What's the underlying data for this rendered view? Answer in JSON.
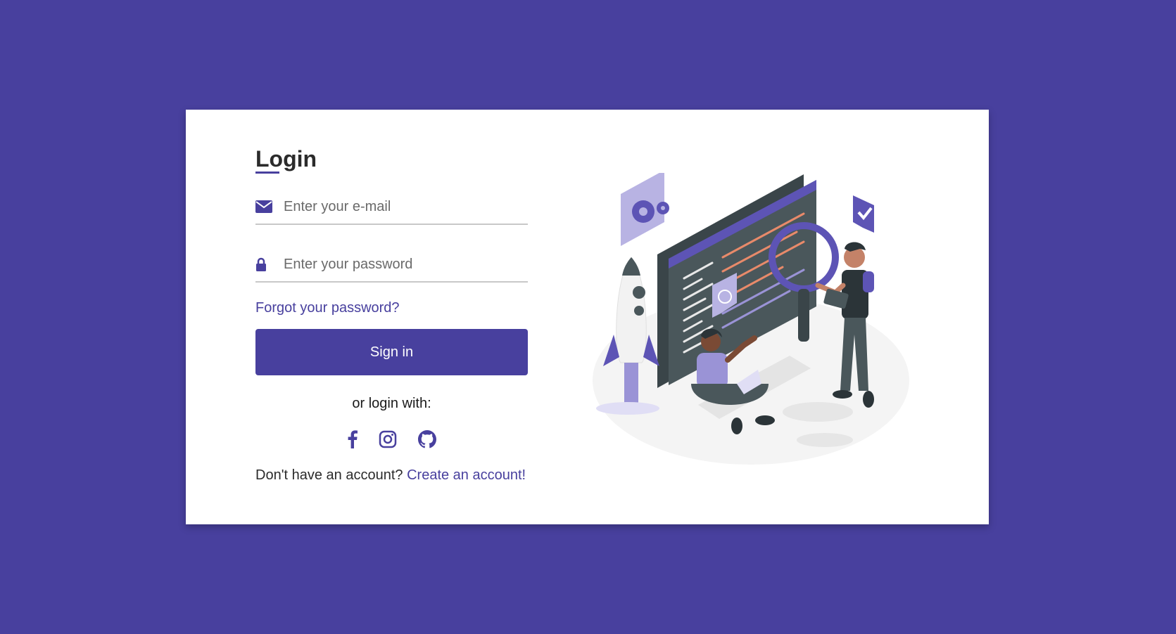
{
  "login": {
    "title": "Login",
    "email_placeholder": "Enter your e-mail",
    "password_placeholder": "Enter your password",
    "forgot_label": "Forgot your password?",
    "signin_label": "Sign in",
    "or_label": "or login with:",
    "signup_prompt": "Don't have an account?",
    "signup_link": "Create an account!"
  },
  "socials": [
    {
      "icon": "facebook-icon"
    },
    {
      "icon": "instagram-icon"
    },
    {
      "icon": "github-icon"
    }
  ],
  "colors": {
    "background": "#48409e",
    "accent": "#48409e",
    "card": "#ffffff"
  }
}
